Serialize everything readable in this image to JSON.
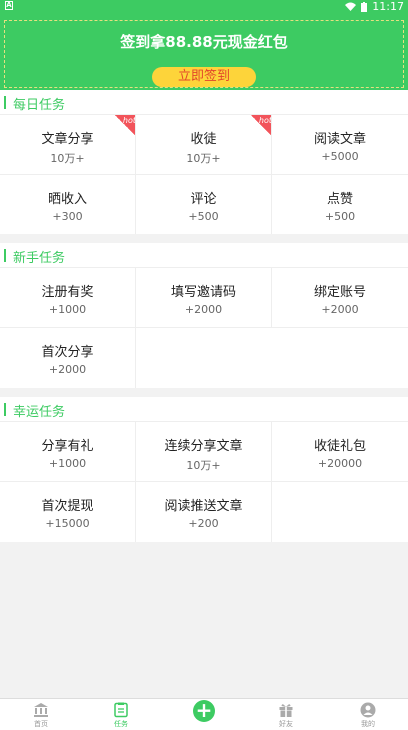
{
  "status_bar": {
    "time": "11:17"
  },
  "banner": {
    "title": "签到拿88.88元现金红包",
    "button": "立即签到"
  },
  "daily": {
    "title": "每日任务",
    "items": [
      {
        "name": "文章分享",
        "reward": "10万+",
        "badge": "hot"
      },
      {
        "name": "收徒",
        "reward": "10万+",
        "badge": "hot"
      },
      {
        "name": "阅读文章",
        "reward": "+5000"
      },
      {
        "name": "晒收入",
        "reward": "+300"
      },
      {
        "name": "评论",
        "reward": "+500"
      },
      {
        "name": "点赞",
        "reward": "+500"
      }
    ]
  },
  "newbie": {
    "title": "新手任务",
    "items": [
      {
        "name": "注册有奖",
        "reward": "+1000"
      },
      {
        "name": "填写邀请码",
        "reward": "+2000"
      },
      {
        "name": "绑定账号",
        "reward": "+2000"
      },
      {
        "name": "首次分享",
        "reward": "+2000"
      }
    ]
  },
  "lucky": {
    "title": "幸运任务",
    "items": [
      {
        "name": "分享有礼",
        "reward": "+1000"
      },
      {
        "name": "连续分享文章",
        "reward": "10万+"
      },
      {
        "name": "收徒礼包",
        "reward": "+20000"
      },
      {
        "name": "首次提现",
        "reward": "+15000"
      },
      {
        "name": "阅读推送文章",
        "reward": "+200"
      }
    ]
  },
  "tabbar": {
    "home": "首页",
    "tasks": "任务",
    "friends": "好友",
    "mine": "我的"
  },
  "colors": {
    "accent": "#3dcb62",
    "button": "#fdd43a",
    "hot": "#f2545b"
  }
}
